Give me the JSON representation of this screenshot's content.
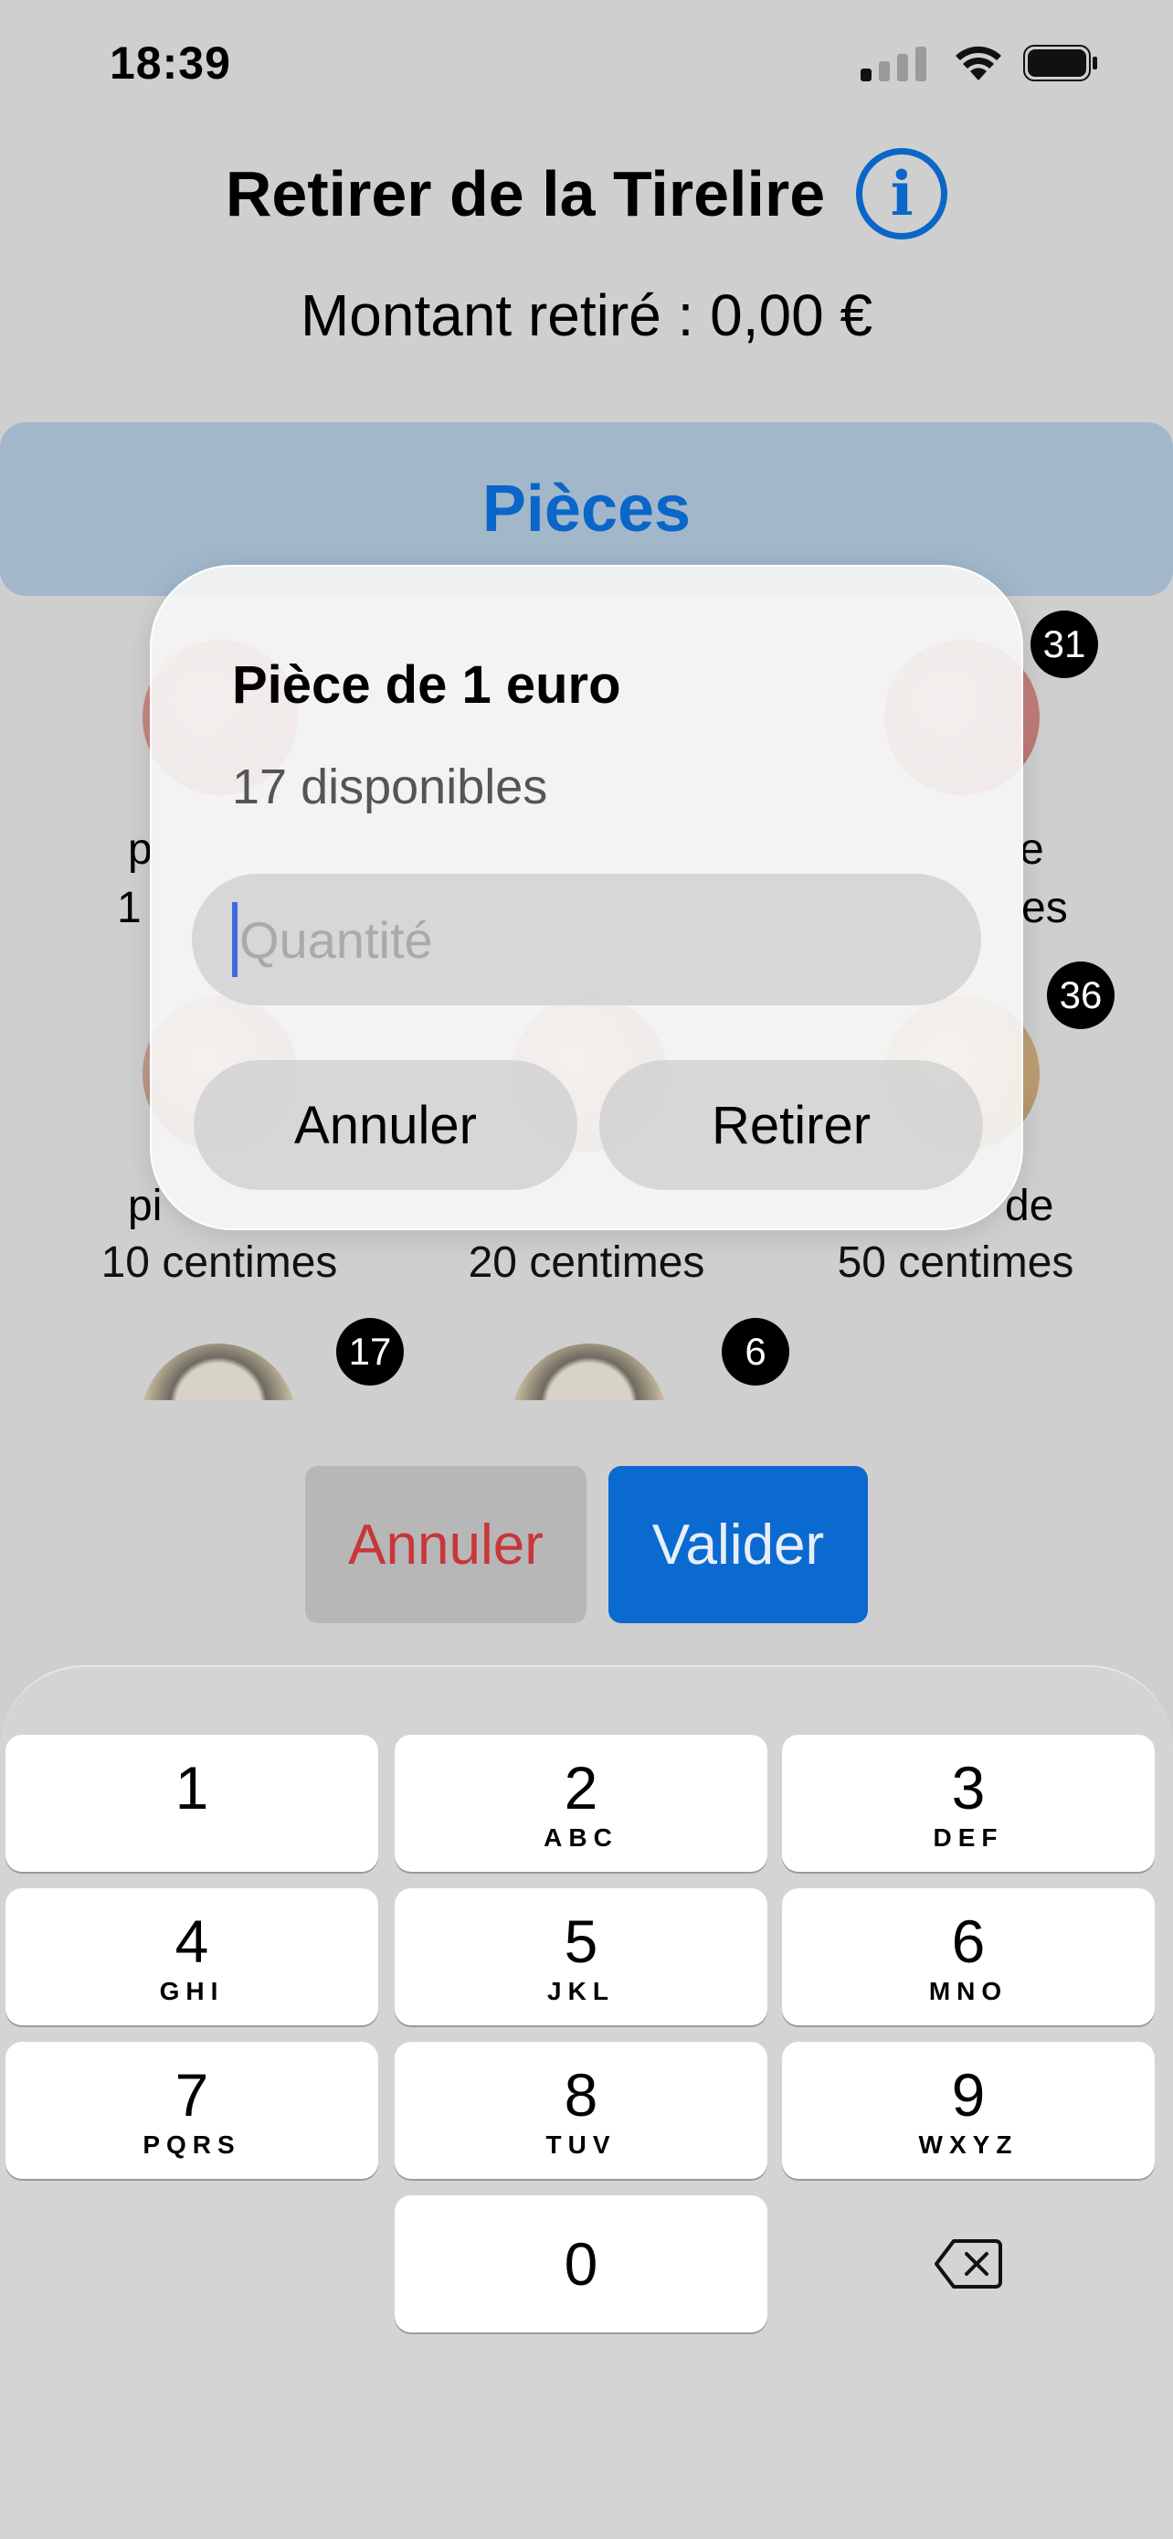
{
  "status": {
    "time": "18:39"
  },
  "header": {
    "title": "Retirer de la Tirelire",
    "info_glyph": "i",
    "amount": "Montant retiré : 0,00 €"
  },
  "tab": {
    "label": "Pièces"
  },
  "coins": {
    "row1": {
      "left_text": "p",
      "left_text2": "1",
      "right_text": "e",
      "right_text2": "es",
      "badge": "31"
    },
    "row2": {
      "labels": [
        "pi",
        "20 centimes",
        "de"
      ],
      "labels2": [
        "10 centimes",
        "",
        "50 centimes"
      ],
      "badge": "36"
    },
    "row3": {
      "badges": [
        "17",
        "6"
      ]
    }
  },
  "dialog": {
    "title": "Pièce de 1 euro",
    "subtitle": "17 disponibles",
    "input_placeholder": "Quantité",
    "cancel": "Annuler",
    "confirm": "Retirer"
  },
  "actions": {
    "cancel": "Annuler",
    "validate": "Valider"
  },
  "keyboard": {
    "keys": [
      {
        "num": "1",
        "letters": ""
      },
      {
        "num": "2",
        "letters": "ABC"
      },
      {
        "num": "3",
        "letters": "DEF"
      },
      {
        "num": "4",
        "letters": "GHI"
      },
      {
        "num": "5",
        "letters": "JKL"
      },
      {
        "num": "6",
        "letters": "MNO"
      },
      {
        "num": "7",
        "letters": "PQRS"
      },
      {
        "num": "8",
        "letters": "TUV"
      },
      {
        "num": "9",
        "letters": "WXYZ"
      },
      {
        "num": "0",
        "letters": ""
      }
    ]
  },
  "colors": {
    "accent": "#0a66c8",
    "danger": "#c7373a",
    "tab_bg": "#a2b7ca"
  }
}
